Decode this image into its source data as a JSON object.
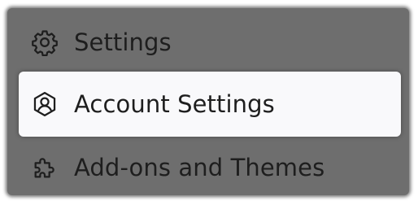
{
  "menu": {
    "items": [
      {
        "label": "Settings",
        "icon": "gear-icon",
        "selected": false
      },
      {
        "label": "Account Settings",
        "icon": "account-icon",
        "selected": true
      },
      {
        "label": "Add-ons and Themes",
        "icon": "puzzle-icon",
        "selected": false
      }
    ]
  },
  "colors": {
    "panel_background": "#6e6e6e",
    "selected_background": "#f9f9fb",
    "text": "#1e1e1e"
  }
}
